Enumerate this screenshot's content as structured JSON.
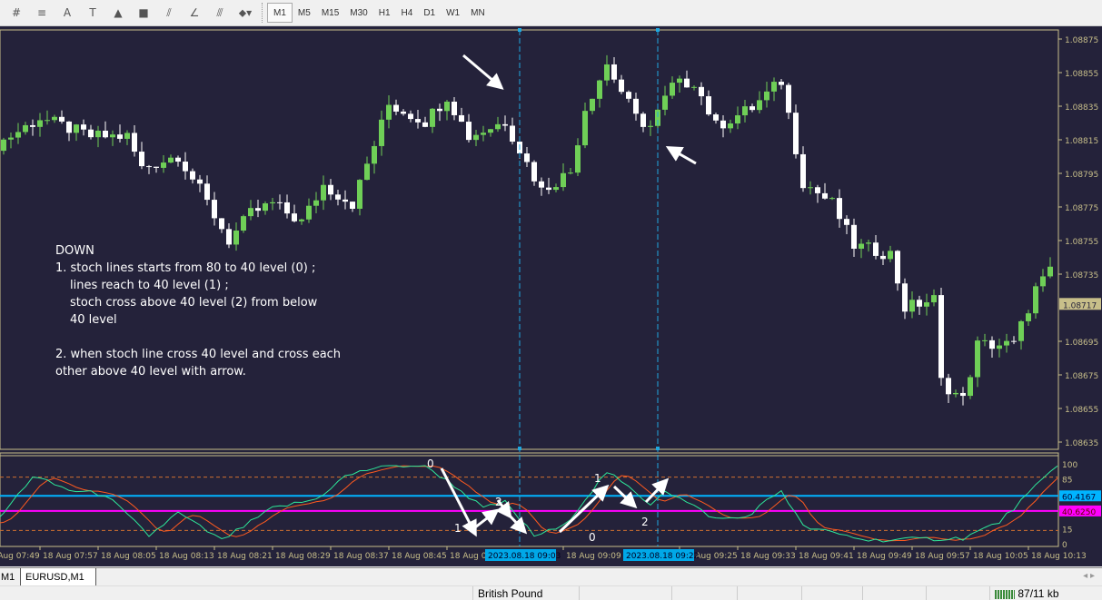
{
  "toolbar": {
    "tools": [
      {
        "icon": "grid-e-icon",
        "glyph": "#"
      },
      {
        "icon": "fibo-lines-icon",
        "glyph": "≡"
      },
      {
        "icon": "text-icon",
        "glyph": "A"
      },
      {
        "icon": "text-label-icon",
        "glyph": "T"
      },
      {
        "icon": "triangle-icon",
        "glyph": "▲"
      },
      {
        "icon": "rectangle-icon",
        "glyph": "■"
      },
      {
        "icon": "fibo-fan-icon",
        "glyph": "⫽"
      },
      {
        "icon": "angle-icon",
        "glyph": "∠"
      },
      {
        "icon": "channel-icon",
        "glyph": "⫻"
      },
      {
        "icon": "arrows-dropdown-icon",
        "glyph": "⬥▾"
      }
    ],
    "timeframes": [
      "M1",
      "M5",
      "M15",
      "M30",
      "H1",
      "H4",
      "D1",
      "W1",
      "MN"
    ],
    "active_timeframe": "M1"
  },
  "chart": {
    "symbol": "EURUSD,M1",
    "colors": {
      "background": "#24223a",
      "bull": "#6fcf57",
      "bear": "#ffffff",
      "frame": "#c8bf8a",
      "stoch_main": "#2ee89a",
      "stoch_signal": "#ff5a1f",
      "level_upper": "#00b4ff",
      "level_lower": "#ff00ff",
      "level_dash": "#d07030",
      "vline": "#1fa8e0"
    },
    "price_labels": [
      "1.08875",
      "1.08855",
      "1.08835",
      "1.08815",
      "1.08795",
      "1.08775",
      "1.08755",
      "1.08735",
      "1.08695",
      "1.08675",
      "1.08655",
      "1.08635"
    ],
    "current_price": "1.08717",
    "time_labels": [
      "18 Aug 07:49",
      "18 Aug 07:57",
      "18 Aug 08:05",
      "18 Aug 08:13",
      "18 Aug 08:21",
      "18 Aug 08:29",
      "18 Aug 08:37",
      "18 Aug 08:45",
      "18 Aug 08:53",
      "18 Aug 09:09",
      "18 Aug 09:25",
      "18 Aug 09:33",
      "18 Aug 09:41",
      "18 Aug 09:49",
      "18 Aug 09:57",
      "18 Aug 10:05",
      "18 Aug 10:13"
    ],
    "crosshair_times": [
      "2023.08.18 09:03",
      "2023.08.18 09:22"
    ],
    "indicator": {
      "levels": [
        "100",
        "85",
        "15",
        "0"
      ],
      "upper_value": "60.4167",
      "lower_value": "40.6250"
    },
    "note": {
      "title": "DOWN",
      "lines": [
        "1. stoch lines starts from 80 to 40 level (0) ;",
        "lines reach to 40 level (1) ;",
        "stoch cross above 40 level (2) from below",
        "40 level",
        "2. when stoch line cross 40 level and cross each",
        "other above 40 level with arrow."
      ]
    },
    "markers": [
      "0",
      "1",
      "2",
      "1",
      "2",
      "0"
    ]
  },
  "chart_data": {
    "type": "candlestick",
    "ylim": [
      1.0863,
      1.0888
    ],
    "close_keypoints": [
      [
        "07:51",
        1.08812
      ],
      [
        "07:57",
        1.08828
      ],
      [
        "08:04",
        1.08817
      ],
      [
        "08:09",
        1.08817
      ],
      [
        "08:11",
        1.08798
      ],
      [
        "08:16",
        1.08806
      ],
      [
        "08:19",
        1.08785
      ],
      [
        "08:23",
        1.08755
      ],
      [
        "08:26",
        1.08771
      ],
      [
        "08:29",
        1.08777
      ],
      [
        "08:33",
        1.08766
      ],
      [
        "08:36",
        1.08788
      ],
      [
        "08:40",
        1.08777
      ],
      [
        "08:43",
        1.08812
      ],
      [
        "08:45",
        1.08836
      ],
      [
        "08:50",
        1.08826
      ],
      [
        "08:53",
        1.08841
      ],
      [
        "08:56",
        1.08817
      ],
      [
        "09:01",
        1.08826
      ],
      [
        "09:04",
        1.08801
      ],
      [
        "09:06",
        1.08785
      ],
      [
        "09:10",
        1.08796
      ],
      [
        "09:12",
        1.08834
      ],
      [
        "09:15",
        1.0886
      ],
      [
        "09:19",
        1.08828
      ],
      [
        "09:21",
        1.08823
      ],
      [
        "09:24",
        1.08847
      ],
      [
        "09:27",
        1.0885
      ],
      [
        "09:30",
        1.08823
      ],
      [
        "09:35",
        1.08834
      ],
      [
        "09:39",
        1.0885
      ],
      [
        "09:42",
        1.0879
      ],
      [
        "09:46",
        1.08777
      ],
      [
        "09:49",
        1.08752
      ],
      [
        "09:54",
        1.08747
      ],
      [
        "09:56",
        1.08715
      ],
      [
        "10:00",
        1.0872
      ],
      [
        "10:01",
        1.08671
      ],
      [
        "10:04",
        1.0866
      ],
      [
        "10:06",
        1.08693
      ],
      [
        "10:11",
        1.08693
      ],
      [
        "10:14",
        1.08726
      ],
      [
        "10:16",
        1.08736
      ]
    ],
    "stoch_keypoints": [
      [
        "07:51",
        26
      ],
      [
        "07:56",
        86
      ],
      [
        "08:01",
        68
      ],
      [
        "08:06",
        62
      ],
      [
        "08:12",
        8
      ],
      [
        "08:16",
        38
      ],
      [
        "08:22",
        2
      ],
      [
        "08:29",
        44
      ],
      [
        "08:35",
        56
      ],
      [
        "08:39",
        86
      ],
      [
        "08:44",
        100
      ],
      [
        "08:50",
        100
      ],
      [
        "08:54",
        74
      ],
      [
        "08:58",
        44
      ],
      [
        "09:01",
        52
      ],
      [
        "09:05",
        8
      ],
      [
        "09:09",
        20
      ],
      [
        "09:15",
        92
      ],
      [
        "09:21",
        50
      ],
      [
        "09:23",
        68
      ],
      [
        "09:30",
        30
      ],
      [
        "09:34",
        32
      ],
      [
        "09:39",
        68
      ],
      [
        "09:42",
        20
      ],
      [
        "09:51",
        2
      ],
      [
        "10:04",
        5
      ],
      [
        "10:09",
        26
      ],
      [
        "10:17",
        100
      ]
    ],
    "stoch_ylim": [
      0,
      100
    ],
    "stoch_levels": [
      85,
      60.4167,
      40.625,
      15
    ]
  },
  "tabs": [
    {
      "label": "M1"
    },
    {
      "label": "EURUSD,M1"
    }
  ],
  "status": {
    "profile": "British Pound",
    "traffic": "87/11 kb"
  }
}
